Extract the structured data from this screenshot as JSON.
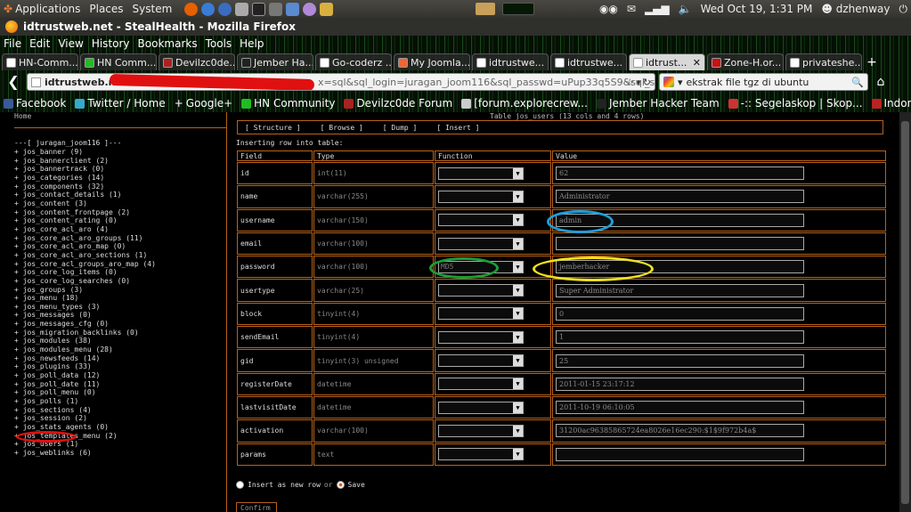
{
  "panel": {
    "menus": [
      "Applications",
      "Places",
      "System"
    ],
    "clock": "Wed Oct 19,  1:31 PM",
    "user": "dzhenway"
  },
  "window": {
    "title": "idtrustweb.net - StealHealth - Mozilla Firefox"
  },
  "menubar": [
    "File",
    "Edit",
    "View",
    "History",
    "Bookmarks",
    "Tools",
    "Help"
  ],
  "tabs": [
    {
      "label": "HN-Comm..."
    },
    {
      "label": "HN Comm..."
    },
    {
      "label": "Devilzc0de..."
    },
    {
      "label": "Jember Ha..."
    },
    {
      "label": "Go-coderz ..."
    },
    {
      "label": "My Joomla..."
    },
    {
      "label": "idtrustwe..."
    },
    {
      "label": "idtrustwe..."
    },
    {
      "label": "idtrust..."
    },
    {
      "label": "Zone-H.or..."
    },
    {
      "label": "privateshe..."
    }
  ],
  "nav": {
    "url_site": "idtrustweb.net",
    "url_rest": "x=sql&sql_login=juragan_joom116&sql_passwd=uPup33q5S9&sql_server=loc",
    "search_text": "ekstrak file tgz di ubuntu"
  },
  "bookmarks": [
    "Facebook",
    "Twitter / Home",
    "Google+",
    "HN Community",
    "Devilzc0de Forum",
    "[forum.explorecrew...",
    "Jember Hacker Team",
    "-:: Segelaskop | Skop...",
    "Indonesian BLackHat ..."
  ],
  "sidebar": {
    "home": "Home",
    "db_header": "---[ juragan_joom116 ]---",
    "tables": [
      "+ jos_banner (9)",
      "+ jos_bannerclient (2)",
      "+ jos_bannertrack (0)",
      "+ jos_categories (14)",
      "+ jos_components (32)",
      "+ jos_contact_details (1)",
      "+ jos_content (3)",
      "+ jos_content_frontpage (2)",
      "+ jos_content_rating (0)",
      "+ jos_core_acl_aro (4)",
      "+ jos_core_acl_aro_groups (11)",
      "+ jos_core_acl_aro_map (0)",
      "+ jos_core_acl_aro_sections (1)",
      "+ jos_core_acl_groups_aro_map (4)",
      "+ jos_core_log_items (0)",
      "+ jos_core_log_searches (0)",
      "+ jos_groups (3)",
      "+ jos_menu (18)",
      "+ jos_menu_types (3)",
      "+ jos_messages (0)",
      "+ jos_messages_cfg (0)",
      "+ jos_migration_backlinks (0)",
      "+ jos_modules (38)",
      "+ jos_modules_menu (28)",
      "+ jos_newsfeeds (14)",
      "+ jos_plugins (33)",
      "+ jos_poll_data (12)",
      "+ jos_poll_date (11)",
      "+ jos_poll_menu (0)",
      "+ jos_polls (1)",
      "+ jos_sections (4)",
      "+ jos_session (2)",
      "+ jos_stats_agents (0)",
      "+ jos_templates_menu (2)",
      "+ jos_users (1)",
      "+ jos_weblinks (6)"
    ]
  },
  "main": {
    "table_title": "Table jos_users (13 cols and 4 rows)",
    "actions": [
      "[ Structure ]",
      "[ Browse ]",
      "[ Dump ]",
      "[ Insert ]"
    ],
    "inserting_label": "Inserting row into table:",
    "headers": [
      "Field",
      "Type",
      "Function",
      "Value"
    ],
    "rows": [
      {
        "field": "id",
        "type": "int(11)",
        "function": "",
        "value": "62"
      },
      {
        "field": "name",
        "type": "varchar(255)",
        "function": "",
        "value": "Administrator"
      },
      {
        "field": "username",
        "type": "varchar(150)",
        "function": "",
        "value": "admin"
      },
      {
        "field": "email",
        "type": "varchar(100)",
        "function": "",
        "value": ""
      },
      {
        "field": "password",
        "type": "varchar(100)",
        "function": "MD5",
        "value": "jemberhacker"
      },
      {
        "field": "usertype",
        "type": "varchar(25)",
        "function": "",
        "value": "Super Administrator"
      },
      {
        "field": "block",
        "type": "tinyint(4)",
        "function": "",
        "value": "0"
      },
      {
        "field": "sendEmail",
        "type": "tinyint(4)",
        "function": "",
        "value": "1"
      },
      {
        "field": "gid",
        "type": "tinyint(3) unsigned",
        "function": "",
        "value": "25"
      },
      {
        "field": "registerDate",
        "type": "datetime",
        "function": "",
        "value": "2011-01-15 23:17:12"
      },
      {
        "field": "lastvisitDate",
        "type": "datetime",
        "function": "",
        "value": "2011-10-19 06:10:05"
      },
      {
        "field": "activation",
        "type": "varchar(100)",
        "function": "",
        "value": "31200ac96385865724ea8026e16ec290:$1$9f972b4a$"
      },
      {
        "field": "params",
        "type": "text",
        "function": "",
        "value": ""
      }
    ],
    "radio_insert_label": "Insert as new row",
    "radio_or": "or",
    "radio_save_label": "Save",
    "confirm_label": "Confirm"
  },
  "colors": {
    "border_orange": "#b8621a",
    "mark_red": "#e01010",
    "mark_blue": "#1aa0e0",
    "mark_green": "#19a03a",
    "mark_yellow": "#f0e020"
  }
}
